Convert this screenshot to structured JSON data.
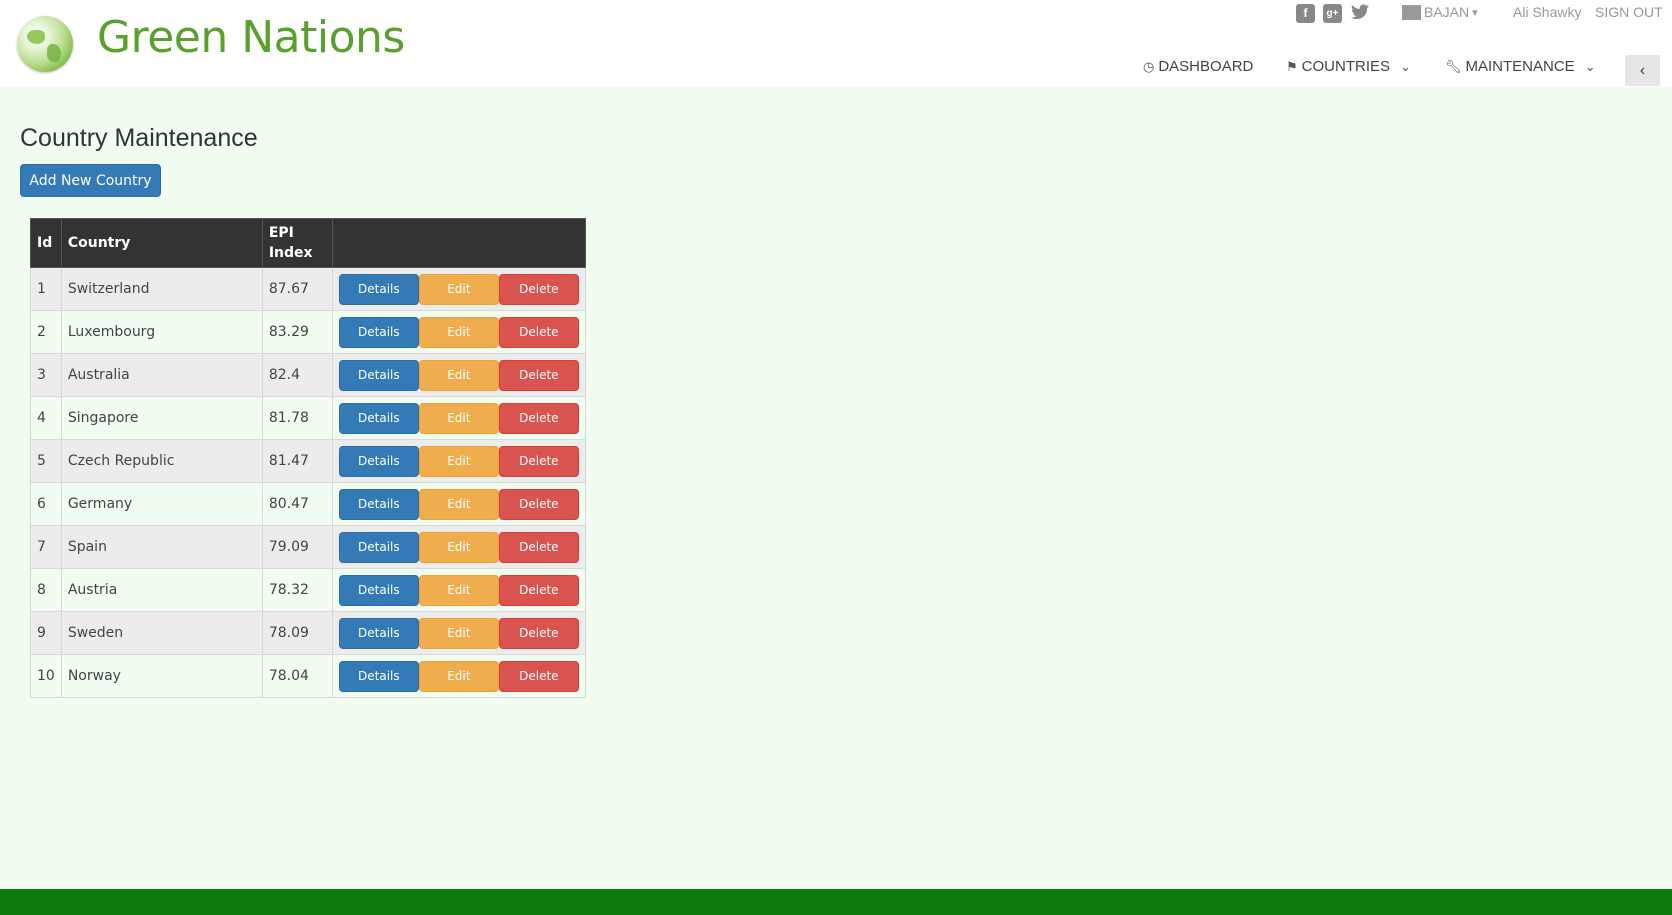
{
  "header": {
    "brand": "Green Nations",
    "social": [
      {
        "name": "facebook-icon",
        "glyph": "f"
      },
      {
        "name": "google-plus-icon",
        "glyph": "g+"
      },
      {
        "name": "twitter-icon",
        "glyph": "🐦"
      }
    ],
    "language": "BAJAN",
    "user": "Ali Shawky",
    "sign_out": "SIGN OUT",
    "nav": [
      {
        "label": "DASHBOARD",
        "icon": "dashboard-icon"
      },
      {
        "label": "COUNTRIES",
        "icon": "flag-icon"
      },
      {
        "label": "MAINTENANCE",
        "icon": "wrench-icon"
      }
    ]
  },
  "main": {
    "title": "Country Maintenance",
    "add_button": "Add New Country",
    "table": {
      "headers": {
        "id": "Id",
        "country": "Country",
        "epi_line1": "EPI",
        "epi_line2": "Index"
      },
      "rows": [
        {
          "id": "1",
          "country": "Switzerland",
          "epi": "87.67"
        },
        {
          "id": "2",
          "country": "Luxembourg",
          "epi": "83.29"
        },
        {
          "id": "3",
          "country": "Australia",
          "epi": "82.4"
        },
        {
          "id": "4",
          "country": "Singapore",
          "epi": "81.78"
        },
        {
          "id": "5",
          "country": "Czech Republic",
          "epi": "81.47"
        },
        {
          "id": "6",
          "country": "Germany",
          "epi": "80.47"
        },
        {
          "id": "7",
          "country": "Spain",
          "epi": "79.09"
        },
        {
          "id": "8",
          "country": "Austria",
          "epi": "78.32"
        },
        {
          "id": "9",
          "country": "Sweden",
          "epi": "78.09"
        },
        {
          "id": "10",
          "country": "Norway",
          "epi": "78.04"
        }
      ],
      "actions": {
        "details": "Details",
        "edit": "Edit",
        "delete": "Delete"
      }
    }
  },
  "colors": {
    "brand_green": "#5aa02c",
    "page_bg": "#f0fdf0",
    "footer_green": "#0d7a0d",
    "primary": "#337ab7",
    "warning": "#f0ad4e",
    "danger": "#d9534f",
    "table_header": "#333333"
  }
}
